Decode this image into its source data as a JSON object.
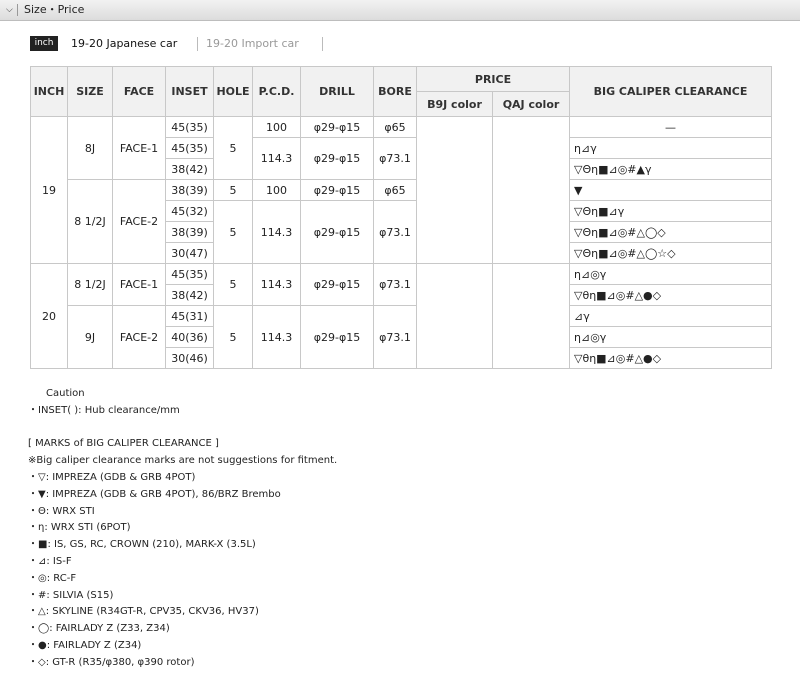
{
  "section": {
    "title": "Size・Price"
  },
  "tabs": {
    "badge": "inch",
    "active": "19-20 Japanese car",
    "inactive": "19-20 Import car"
  },
  "table": {
    "headers": {
      "inch": "INCH",
      "size": "SIZE",
      "face": "FACE",
      "inset": "INSET",
      "hole": "HOLE",
      "pcd": "P.C.D.",
      "drill": "DRILL",
      "bore": "BORE",
      "price": "PRICE",
      "b9j": "B9J color",
      "qaj": "QAJ color",
      "clearance": "BIG CALIPER CLEARANCE"
    },
    "inch19": "19",
    "inch20": "20",
    "g1": {
      "size": "8J",
      "face": "FACE-1",
      "hole": "5",
      "pcd_a": "100",
      "drill_a": "φ29-φ15",
      "bore_a": "φ65",
      "pcd_b": "114.3",
      "drill_b": "φ29-φ15",
      "bore_b": "φ73.1",
      "insets": [
        "45(35)",
        "45(35)",
        "38(42)"
      ],
      "marks": [
        "—",
        "η⊿γ",
        "▽Θη■⊿◎#▲γ"
      ]
    },
    "g2": {
      "inset": "38(39)",
      "hole": "5",
      "pcd": "100",
      "drill": "φ29-φ15",
      "bore": "φ65",
      "mark": "▼"
    },
    "g3": {
      "size": "8 1/2J",
      "face": "FACE-2",
      "hole": "5",
      "pcd": "114.3",
      "drill": "φ29-φ15",
      "bore": "φ73.1",
      "insets": [
        "45(32)",
        "38(39)",
        "30(47)"
      ],
      "marks": [
        "▽Θη■⊿γ",
        "▽Θη■⊿◎#△◯◇",
        "▽Θη■⊿◎#△◯☆◇"
      ]
    },
    "g4": {
      "size": "8 1/2J",
      "face": "FACE-1",
      "hole": "5",
      "pcd": "114.3",
      "drill": "φ29-φ15",
      "bore": "φ73.1",
      "insets": [
        "45(35)",
        "38(42)"
      ],
      "marks": [
        "η⊿◎γ",
        "▽θη■⊿◎#△●◇"
      ]
    },
    "g5": {
      "size": "9J",
      "face": "FACE-2",
      "hole": "5",
      "pcd": "114.3",
      "drill": "φ29-φ15",
      "bore": "φ73.1",
      "insets": [
        "45(31)",
        "40(36)",
        "30(46)"
      ],
      "marks": [
        "⊿γ",
        "η⊿◎γ",
        "▽θη■⊿◎#△●◇"
      ]
    }
  },
  "notes": {
    "caution": "Caution",
    "inset": "・INSET( ): Hub clearance/mm",
    "marks_title": "[ MARKS of BIG CALIPER CLEARANCE ]",
    "disclaimer": "※Big caliper clearance marks are not suggestions for fitment.",
    "items": [
      "・▽: IMPREZA (GDB & GRB 4POT)",
      "・▼: IMPREZA (GDB & GRB 4POT), 86/BRZ Brembo",
      "・Θ: WRX STI",
      "・η: WRX STI (6POT)",
      "・■: IS, GS, RC, CROWN (210), MARK-X (3.5L)",
      "・⊿: IS-F",
      "・◎: RC-F",
      "・#: SILVIA (S15)",
      "・△: SKYLINE (R34GT-R, CPV35, CKV36, HV37)",
      "・◯: FAIRLADY Z (Z33, Z34)",
      "・●: FAIRLADY Z (Z34)",
      "・◇: GT-R (R35/φ380, φ390 rotor)"
    ]
  }
}
